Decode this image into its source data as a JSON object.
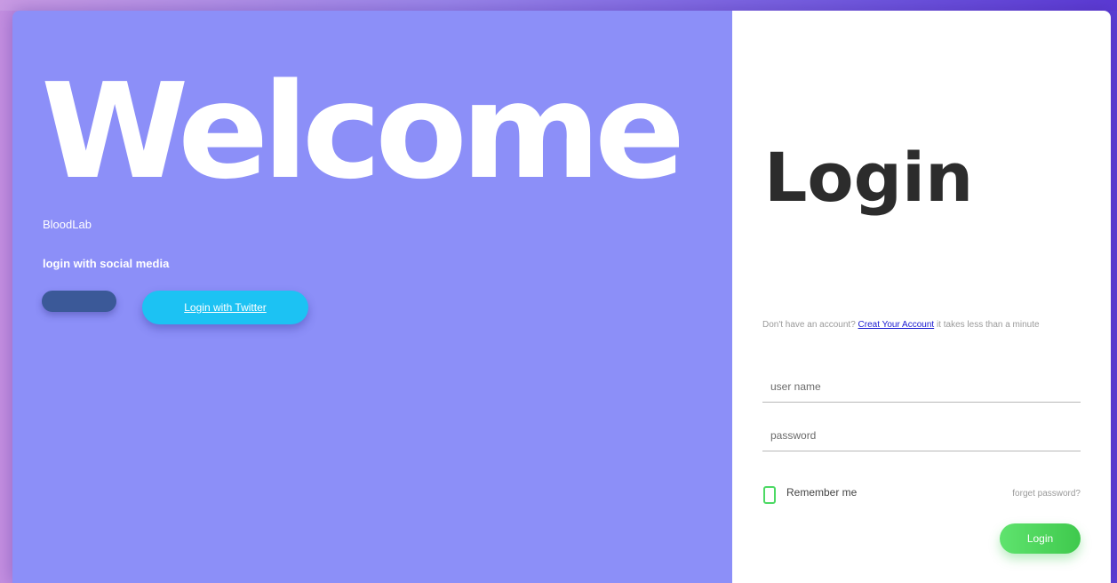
{
  "welcome_panel": {
    "heading": "Welcome",
    "brand": "BloodLab",
    "social_title": "login with social media",
    "facebook_button_label": "",
    "twitter_button_label": "Login with Twitter"
  },
  "login_panel": {
    "heading": "Login",
    "signup_prompt": "Don't have an account?",
    "signup_link": "Creat Your Account",
    "signup_suffix": "it takes less than a minute",
    "username_placeholder": "user name",
    "password_placeholder": "password",
    "remember_label": "Remember me",
    "forgot_link": "forget password?",
    "login_button_label": "Login"
  },
  "colors": {
    "left_panel": "#8c8ff8",
    "facebook": "#3b5998",
    "twitter": "#1cc2f3",
    "login_button": "#4cd964",
    "link": "#1a1ad0"
  }
}
